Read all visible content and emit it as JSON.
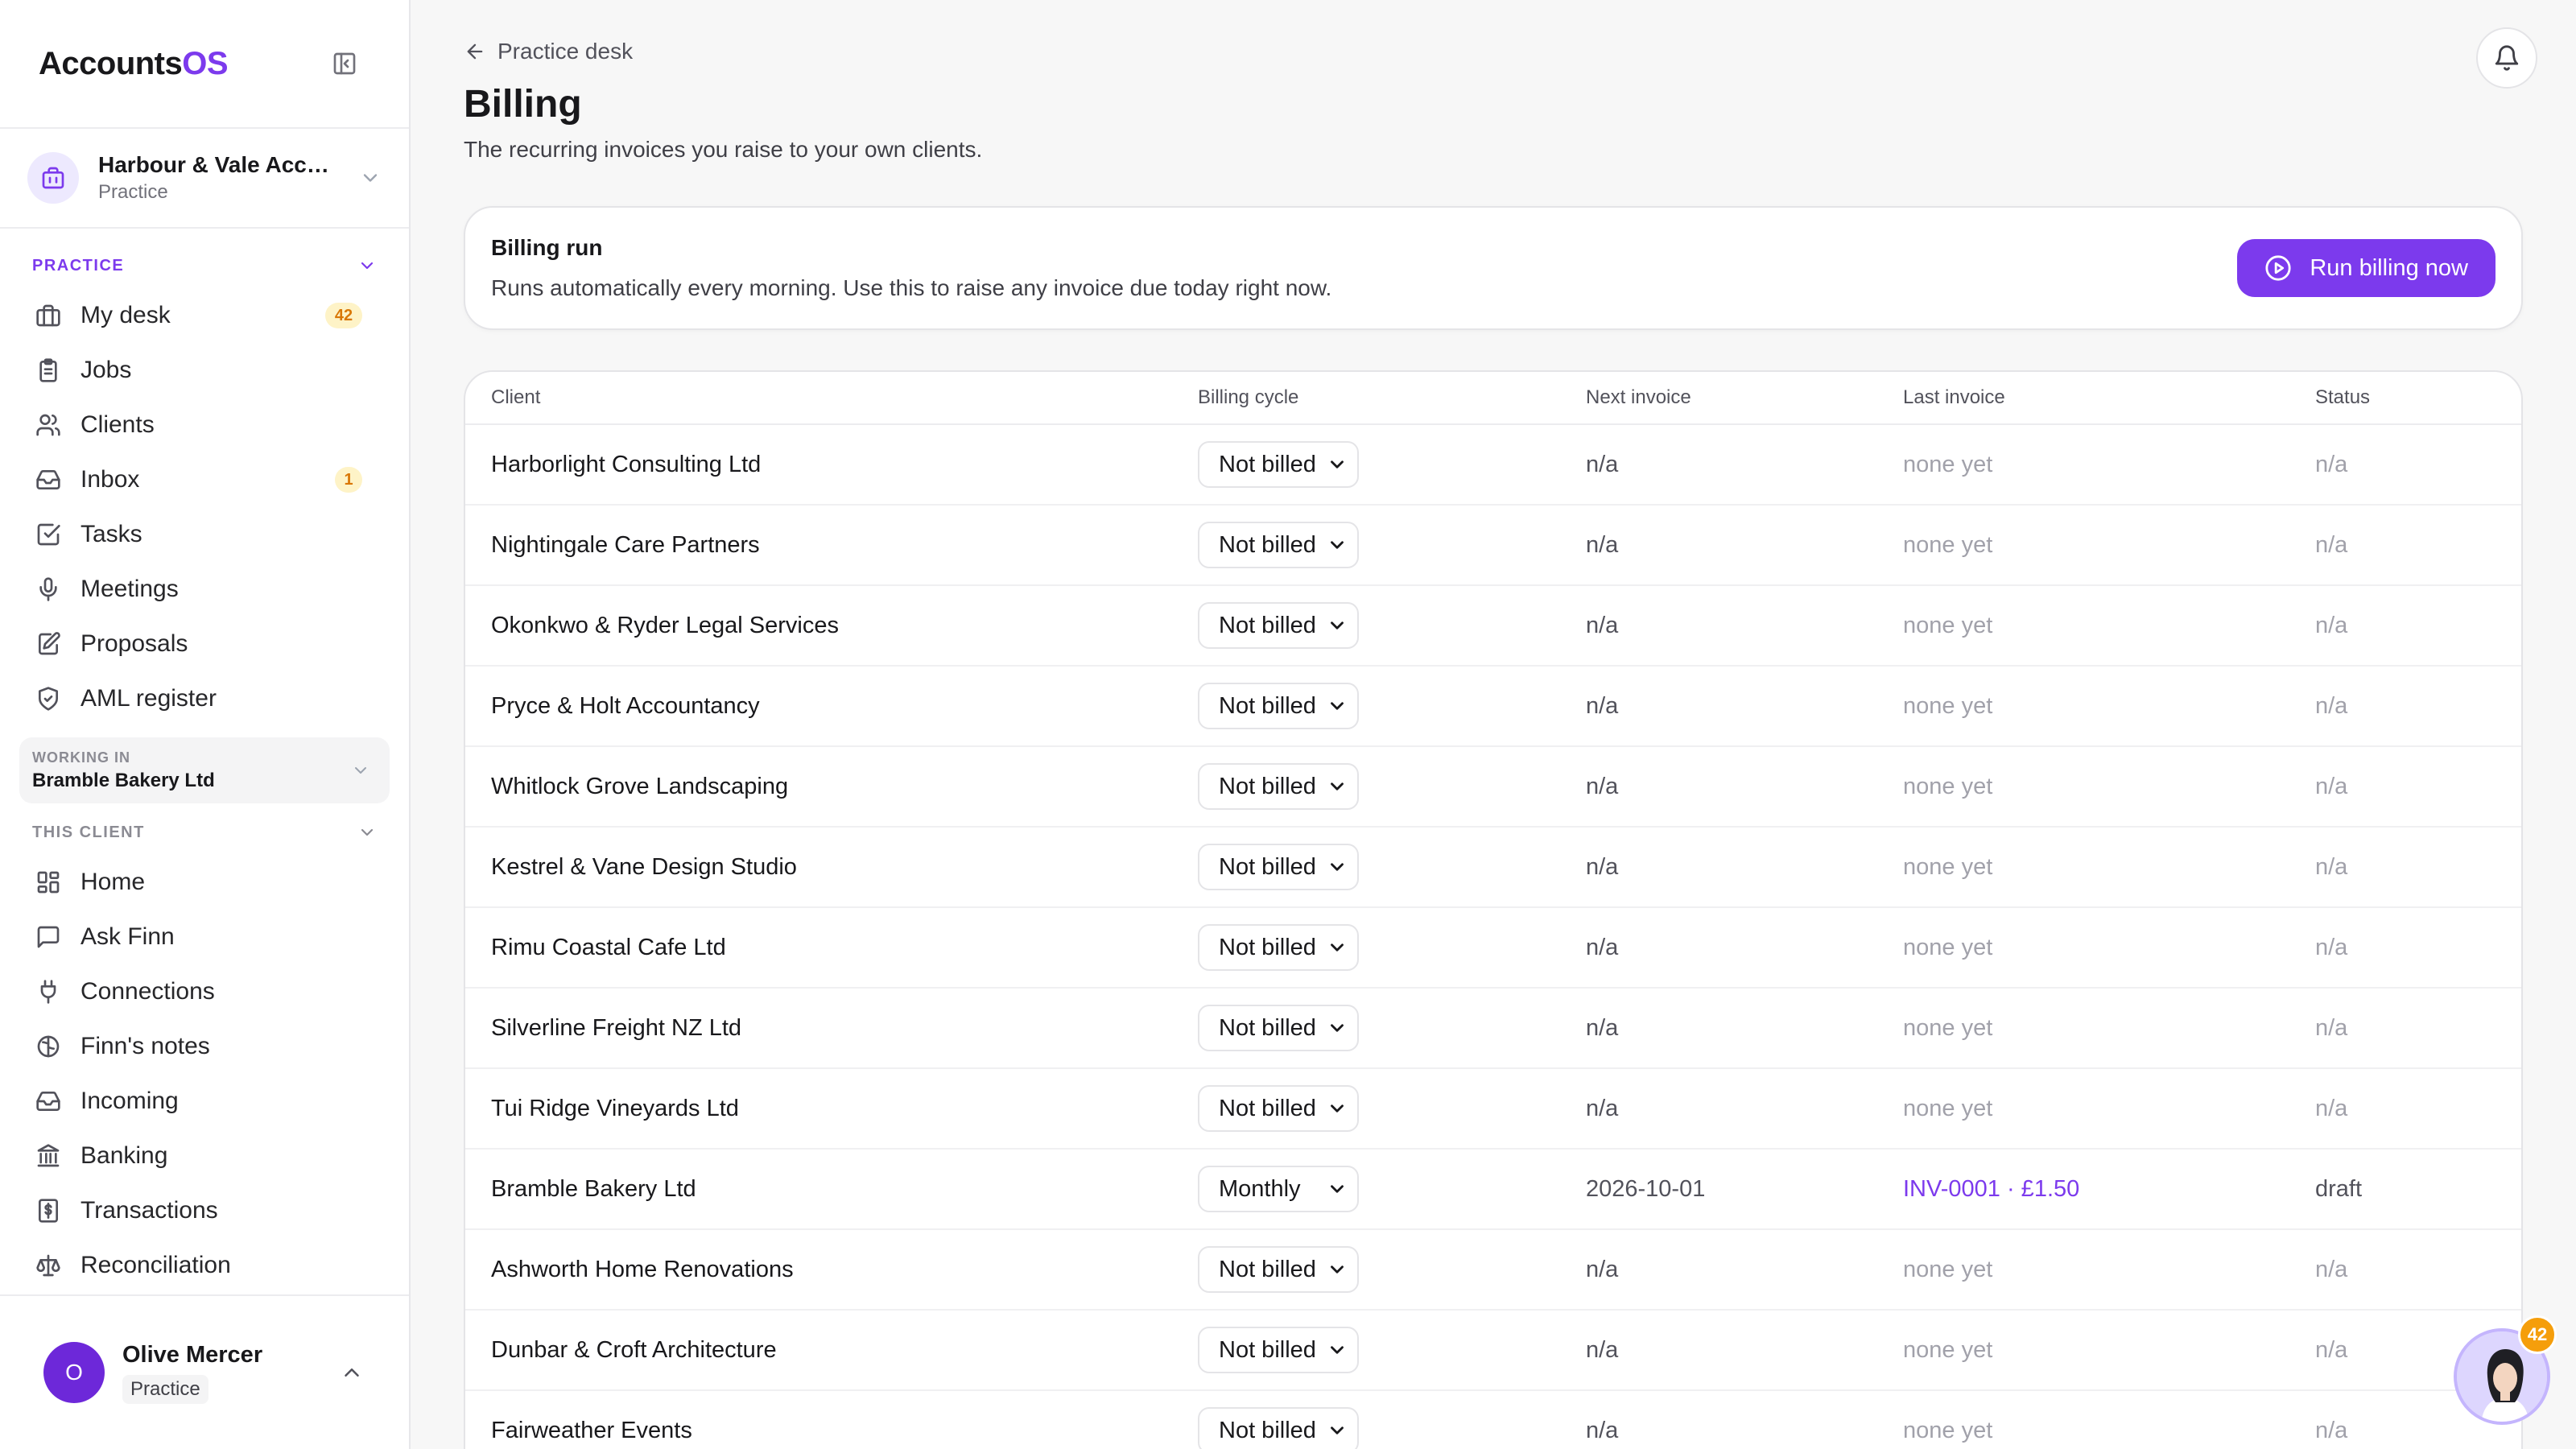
{
  "brand": {
    "name_main": "Accounts",
    "name_accent": "OS"
  },
  "org": {
    "name": "Harbour & Vale Accou...",
    "type": "Practice"
  },
  "practice_section": {
    "heading": "PRACTICE",
    "items": [
      {
        "label": "My desk",
        "icon": "briefcase-icon",
        "badge": "42"
      },
      {
        "label": "Jobs",
        "icon": "clipboard-icon",
        "badge": ""
      },
      {
        "label": "Clients",
        "icon": "users-icon",
        "badge": ""
      },
      {
        "label": "Inbox",
        "icon": "inbox-icon",
        "badge": "1"
      },
      {
        "label": "Tasks",
        "icon": "checkbox-icon",
        "badge": ""
      },
      {
        "label": "Meetings",
        "icon": "microphone-icon",
        "badge": ""
      },
      {
        "label": "Proposals",
        "icon": "document-edit-icon",
        "badge": ""
      },
      {
        "label": "AML register",
        "icon": "shield-icon",
        "badge": ""
      }
    ]
  },
  "working_in": {
    "label": "WORKING IN",
    "value": "Bramble Bakery Ltd"
  },
  "client_section": {
    "heading": "THIS CLIENT",
    "items": [
      {
        "label": "Home",
        "icon": "grid-icon"
      },
      {
        "label": "Ask Finn",
        "icon": "chat-icon"
      },
      {
        "label": "Connections",
        "icon": "plug-icon"
      },
      {
        "label": "Finn's notes",
        "icon": "brain-icon"
      },
      {
        "label": "Incoming",
        "icon": "tray-icon"
      },
      {
        "label": "Banking",
        "icon": "bank-icon"
      },
      {
        "label": "Transactions",
        "icon": "receipt-icon"
      },
      {
        "label": "Reconciliation",
        "icon": "scale-icon"
      }
    ]
  },
  "user": {
    "initial": "O",
    "name": "Olive Mercer",
    "role": "Practice"
  },
  "header": {
    "back_label": "Practice desk",
    "title": "Billing",
    "subtitle": "The recurring invoices you raise to your own clients."
  },
  "billing_run": {
    "title": "Billing run",
    "description": "Runs automatically every morning. Use this to raise any invoice due today right now.",
    "button_label": "Run billing now"
  },
  "table": {
    "columns": [
      "Client",
      "Billing cycle",
      "Next invoice",
      "Last invoice",
      "Status"
    ],
    "rows": [
      {
        "client": "Harborlight Consulting Ltd",
        "cycle": "Not billed",
        "next": "n/a",
        "last": "none yet",
        "status": "n/a"
      },
      {
        "client": "Nightingale Care Partners",
        "cycle": "Not billed",
        "next": "n/a",
        "last": "none yet",
        "status": "n/a"
      },
      {
        "client": "Okonkwo & Ryder Legal Services",
        "cycle": "Not billed",
        "next": "n/a",
        "last": "none yet",
        "status": "n/a"
      },
      {
        "client": "Pryce & Holt Accountancy",
        "cycle": "Not billed",
        "next": "n/a",
        "last": "none yet",
        "status": "n/a"
      },
      {
        "client": "Whitlock Grove Landscaping",
        "cycle": "Not billed",
        "next": "n/a",
        "last": "none yet",
        "status": "n/a"
      },
      {
        "client": "Kestrel & Vane Design Studio",
        "cycle": "Not billed",
        "next": "n/a",
        "last": "none yet",
        "status": "n/a"
      },
      {
        "client": "Rimu Coastal Cafe Ltd",
        "cycle": "Not billed",
        "next": "n/a",
        "last": "none yet",
        "status": "n/a"
      },
      {
        "client": "Silverline Freight NZ Ltd",
        "cycle": "Not billed",
        "next": "n/a",
        "last": "none yet",
        "status": "n/a"
      },
      {
        "client": "Tui Ridge Vineyards Ltd",
        "cycle": "Not billed",
        "next": "n/a",
        "last": "none yet",
        "status": "n/a"
      },
      {
        "client": "Bramble Bakery Ltd",
        "cycle": "Monthly",
        "next": "2026-10-01",
        "last": "INV-0001 · £1.50",
        "status": "draft"
      },
      {
        "client": "Ashworth Home Renovations",
        "cycle": "Not billed",
        "next": "n/a",
        "last": "none yet",
        "status": "n/a"
      },
      {
        "client": "Dunbar & Croft Architecture",
        "cycle": "Not billed",
        "next": "n/a",
        "last": "none yet",
        "status": "n/a"
      },
      {
        "client": "Fairweather Events",
        "cycle": "Not billed",
        "next": "n/a",
        "last": "none yet",
        "status": "n/a"
      }
    ]
  },
  "assistant": {
    "badge": "42"
  },
  "colors": {
    "accent": "#7c3aed",
    "badge_bg": "#fef3c7",
    "badge_fg": "#d97706"
  }
}
